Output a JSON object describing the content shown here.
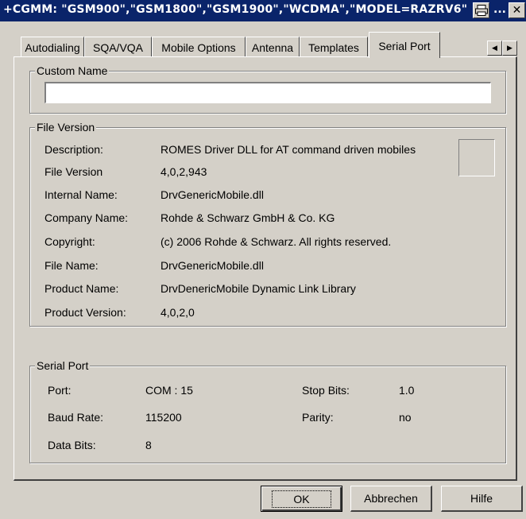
{
  "window": {
    "title": "+CGMM: \"GSM900\",\"GSM1800\",\"GSM1900\",\"WCDMA\",\"MODEL=RAZRV6\"",
    "title_ellipsis": "...",
    "close_glyph": "✕",
    "title_icon": "printer-icon"
  },
  "tabs": [
    {
      "label": "Autodialing"
    },
    {
      "label": "SQA/VQA"
    },
    {
      "label": "Mobile Options"
    },
    {
      "label": "Antenna"
    },
    {
      "label": "Templates"
    },
    {
      "label": "Serial Port",
      "active": true
    }
  ],
  "tab_scroll": {
    "left": "◀",
    "right": "▶"
  },
  "custom_name": {
    "legend": "Custom Name",
    "value": ""
  },
  "file_version": {
    "legend": "File Version",
    "rows": [
      {
        "label": "Description:",
        "value": "ROMES Driver DLL for AT command driven mobiles"
      },
      {
        "label": "File Version",
        "value": "4,0,2,943"
      },
      {
        "label": "Internal Name:",
        "value": "DrvGenericMobile.dll"
      },
      {
        "label": "Company Name:",
        "value": "Rohde & Schwarz GmbH & Co. KG"
      },
      {
        "label": "Copyright:",
        "value": "(c) 2006 Rohde & Schwarz. All rights reserved."
      },
      {
        "label": "File Name:",
        "value": "DrvGenericMobile.dll"
      },
      {
        "label": "Product Name:",
        "value": "DrvDenericMobile Dynamic Link Library"
      },
      {
        "label": "Product Version:",
        "value": "4,0,2,0"
      }
    ]
  },
  "serial_port": {
    "legend": "Serial Port",
    "port_label": "Port:",
    "port_value": "COM : 15",
    "baud_label": "Baud Rate:",
    "baud_value": "115200",
    "databits_label": "Data Bits:",
    "databits_value": "8",
    "stopbits_label": "Stop Bits:",
    "stopbits_value": "1.0",
    "parity_label": "Parity:",
    "parity_value": "no"
  },
  "buttons": {
    "ok": "OK",
    "cancel": "Abbrechen",
    "help": "Hilfe"
  }
}
